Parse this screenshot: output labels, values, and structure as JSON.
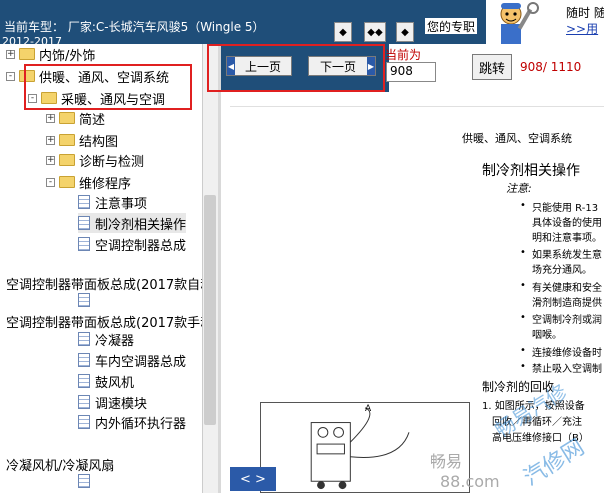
{
  "header": {
    "vehicle_label": "当前车型：  厂家:C-长城汽车风骏5（Wingle 5）",
    "vehicle_year": "2012-2017",
    "pro_text": "您的专职",
    "nav_buttons": [
      "◆",
      "◆◆",
      "◆"
    ],
    "ad": {
      "line1": "随时 随",
      "link": ">>用",
      "mascot_icon": "mechanic-mascot-icon"
    }
  },
  "tree": {
    "items": [
      {
        "label": "内饰/外饰",
        "type": "folder",
        "expander": "+",
        "indent": 0
      },
      {
        "label": "供暖、通风、空调系统",
        "type": "folder",
        "expander": "-",
        "indent": 0
      },
      {
        "label": "采暖、通风与空调",
        "type": "folder",
        "expander": "-",
        "indent": 1
      },
      {
        "label": "简述",
        "type": "folder",
        "expander": "+",
        "indent": 2
      },
      {
        "label": "结构图",
        "type": "folder",
        "expander": "+",
        "indent": 2
      },
      {
        "label": "诊断与检测",
        "type": "folder",
        "expander": "+",
        "indent": 2
      },
      {
        "label": "维修程序",
        "type": "folder",
        "expander": "-",
        "indent": 2
      },
      {
        "label": "注意事项",
        "type": "doc",
        "indent": 3
      },
      {
        "label": "制冷剂相关操作",
        "type": "doc",
        "indent": 3,
        "selected": true
      },
      {
        "label": "空调控制器总成",
        "type": "doc",
        "indent": 3
      },
      {
        "label": "空调控制器带面板总成(2017款自动",
        "type": "text",
        "indent": 0
      },
      {
        "label": "",
        "type": "doc",
        "indent": 3
      },
      {
        "label": "空调控制器带面板总成(2017款手动",
        "type": "text",
        "indent": 0
      },
      {
        "label": "冷凝器",
        "type": "doc",
        "indent": 3
      },
      {
        "label": "车内空调器总成",
        "type": "doc",
        "indent": 3
      },
      {
        "label": "鼓风机",
        "type": "doc",
        "indent": 3
      },
      {
        "label": "调速模块",
        "type": "doc",
        "indent": 3
      },
      {
        "label": "内外循环执行器",
        "type": "doc",
        "indent": 3
      },
      {
        "label": "冷凝风机/冷凝风扇",
        "type": "text",
        "indent": 0
      },
      {
        "label": "",
        "type": "doc",
        "indent": 3
      }
    ]
  },
  "pager": {
    "prev_label": "上一页",
    "next_label": "下一页",
    "current_label": "当前为",
    "current_value": "908",
    "jump_label": "跳转",
    "page_count": "908/ 1110",
    "corner_button": "< >"
  },
  "document": {
    "section": "供暖、通风、空调系统",
    "title": "制冷剂相关操作",
    "notice": "注意:",
    "lines": [
      "只能使用 R-13",
      "具体设备的使用",
      "明和注意事项。",
      "如果系统发生意",
      "场充分通风。",
      "有关健康和安全",
      "滑剂制造商提供",
      "空调制冷剂或润",
      "咽喉。",
      "连接维修设备时",
      "禁止吸入空调制"
    ],
    "subheading": "制冷剂的回收",
    "steps": [
      "1. 如图所示，按照设备",
      "回收／再循环／充注",
      "高电压维修接口（B）"
    ],
    "figure_label": "A",
    "watermarks": [
      "畅易汽修",
      "畅易",
      "88.com",
      "汽修网"
    ]
  }
}
